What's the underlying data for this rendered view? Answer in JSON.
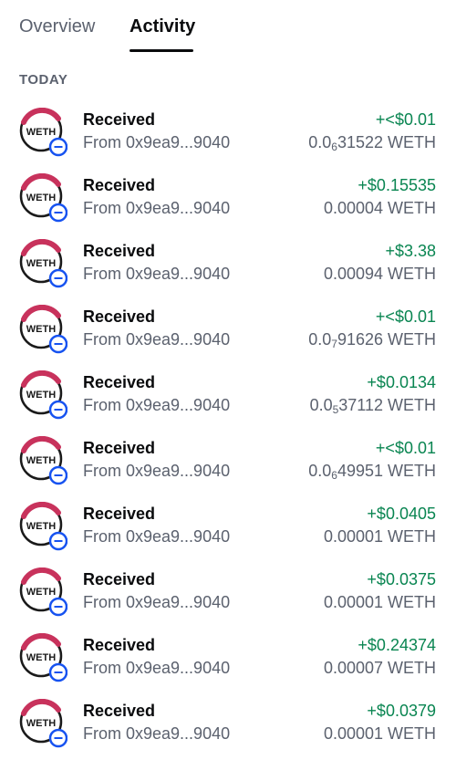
{
  "tabs": [
    {
      "label": "Overview",
      "active": false
    },
    {
      "label": "Activity",
      "active": true
    }
  ],
  "section": {
    "label": "TODAY"
  },
  "colors": {
    "positive": "#098551",
    "muted": "#5b616e",
    "weth_ring": "#c8325c",
    "badge_blue": "#1652f0"
  },
  "asset": {
    "symbol": "WETH",
    "icon": "weth-token-icon",
    "badge_icon": "ethereum-network-badge-icon"
  },
  "transactions": [
    {
      "title": "Received",
      "from": "From 0x9ea9...9040",
      "fiat": "+<$0.01",
      "crypto_prefix": "0.0",
      "crypto_sub": "6",
      "crypto_rest": "31522 WETH"
    },
    {
      "title": "Received",
      "from": "From 0x9ea9...9040",
      "fiat": "+$0.15535",
      "crypto_prefix": "0.00004 WETH",
      "crypto_sub": "",
      "crypto_rest": ""
    },
    {
      "title": "Received",
      "from": "From 0x9ea9...9040",
      "fiat": "+$3.38",
      "crypto_prefix": "0.00094 WETH",
      "crypto_sub": "",
      "crypto_rest": ""
    },
    {
      "title": "Received",
      "from": "From 0x9ea9...9040",
      "fiat": "+<$0.01",
      "crypto_prefix": "0.0",
      "crypto_sub": "7",
      "crypto_rest": "91626 WETH"
    },
    {
      "title": "Received",
      "from": "From 0x9ea9...9040",
      "fiat": "+$0.0134",
      "crypto_prefix": "0.0",
      "crypto_sub": "5",
      "crypto_rest": "37112 WETH"
    },
    {
      "title": "Received",
      "from": "From 0x9ea9...9040",
      "fiat": "+<$0.01",
      "crypto_prefix": "0.0",
      "crypto_sub": "6",
      "crypto_rest": "49951 WETH"
    },
    {
      "title": "Received",
      "from": "From 0x9ea9...9040",
      "fiat": "+$0.0405",
      "crypto_prefix": "0.00001 WETH",
      "crypto_sub": "",
      "crypto_rest": ""
    },
    {
      "title": "Received",
      "from": "From 0x9ea9...9040",
      "fiat": "+$0.0375",
      "crypto_prefix": "0.00001 WETH",
      "crypto_sub": "",
      "crypto_rest": ""
    },
    {
      "title": "Received",
      "from": "From 0x9ea9...9040",
      "fiat": "+$0.24374",
      "crypto_prefix": "0.00007 WETH",
      "crypto_sub": "",
      "crypto_rest": ""
    },
    {
      "title": "Received",
      "from": "From 0x9ea9...9040",
      "fiat": "+$0.0379",
      "crypto_prefix": "0.00001 WETH",
      "crypto_sub": "",
      "crypto_rest": ""
    }
  ]
}
